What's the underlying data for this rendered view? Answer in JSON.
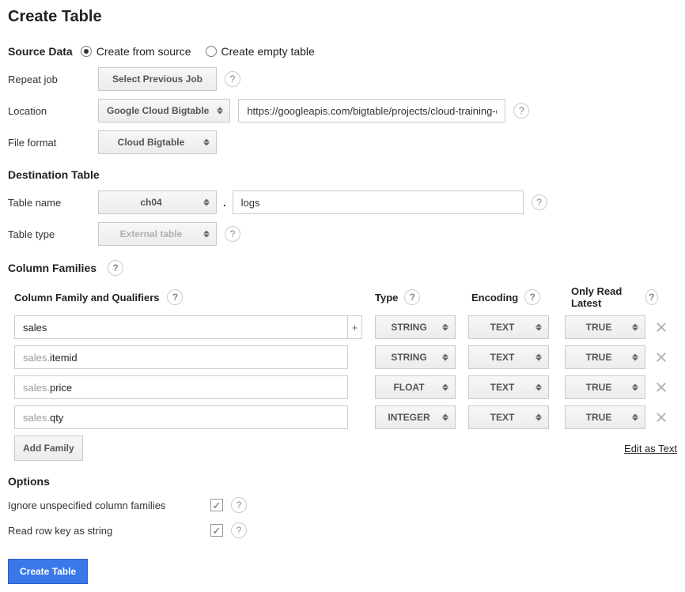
{
  "page_title": "Create Table",
  "source": {
    "heading": "Source Data",
    "radio_from_source": "Create from source",
    "radio_empty": "Create empty table",
    "repeat_label": "Repeat job",
    "repeat_button": "Select Previous Job",
    "location_label": "Location",
    "location_select": "Google Cloud Bigtable",
    "location_value": "https://googleapis.com/bigtable/projects/cloud-training-d",
    "format_label": "File format",
    "format_select": "Cloud Bigtable"
  },
  "destination": {
    "heading": "Destination Table",
    "name_label": "Table name",
    "dataset": "ch04",
    "table": "logs",
    "type_label": "Table type",
    "type_select": "External table"
  },
  "cf": {
    "heading": "Column Families",
    "col_cfq": "Column Family and Qualifiers",
    "col_type": "Type",
    "col_encoding": "Encoding",
    "col_orl": "Only Read Latest",
    "rows": [
      {
        "prefix": "",
        "value": "sales",
        "type": "STRING",
        "encoding": "TEXT",
        "orl": "TRUE",
        "is_family": true
      },
      {
        "prefix": "sales.",
        "value": "itemid",
        "type": "STRING",
        "encoding": "TEXT",
        "orl": "TRUE",
        "is_family": false
      },
      {
        "prefix": "sales.",
        "value": "price",
        "type": "FLOAT",
        "encoding": "TEXT",
        "orl": "TRUE",
        "is_family": false
      },
      {
        "prefix": "sales.",
        "value": "qty",
        "type": "INTEGER",
        "encoding": "TEXT",
        "orl": "TRUE",
        "is_family": false
      }
    ],
    "add_family": "Add Family",
    "edit_text": "Edit as Text"
  },
  "options": {
    "heading": "Options",
    "ignore_label": "Ignore unspecified column families",
    "rowkey_label": "Read row key as string"
  },
  "submit": "Create Table"
}
